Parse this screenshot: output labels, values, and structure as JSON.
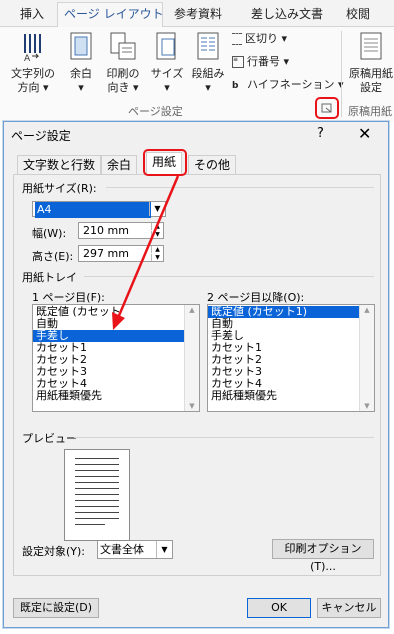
{
  "ribbon": {
    "tabs": [
      "挿入",
      "ページ レイアウト",
      "参考資料",
      "差し込み文書",
      "校閲"
    ],
    "active_tab": "ページ レイアウト",
    "buttons": [
      {
        "line1": "文字列の",
        "line2": "方向 ▾"
      },
      {
        "line1": "余白",
        "line2": "▾"
      },
      {
        "line1": "印刷の",
        "line2": "向き ▾"
      },
      {
        "line1": "サイズ",
        "line2": "▾"
      },
      {
        "line1": "段組み",
        "line2": "▾"
      }
    ],
    "small_buttons": [
      "区切り ▾",
      "行番号 ▾",
      "ハイフネーション ▾"
    ],
    "group_label": "ページ設定",
    "right_button": {
      "line1": "原稿用紙",
      "line2": "設定"
    },
    "right_group_label": "原稿用紙"
  },
  "dialog": {
    "title": "ページ設定",
    "help": "?",
    "close": "✕",
    "tabs": [
      "文字数と行数",
      "余白",
      "用紙",
      "その他"
    ],
    "selected_tab": "用紙",
    "paper_size": {
      "label": "用紙サイズ(R):",
      "value": "A4",
      "width_label": "幅(W):",
      "width_value": "210 mm",
      "height_label": "高さ(E):",
      "height_value": "297 mm"
    },
    "paper_tray": {
      "label": "用紙トレイ",
      "first_page_label": "1 ページ目(F):",
      "first_page_items": [
        "既定値 (カセット",
        "自動",
        "手差し",
        "カセット1",
        "カセット2",
        "カセット3",
        "カセット4",
        "用紙種類優先"
      ],
      "first_page_selected": 2,
      "other_pages_label": "2 ページ目以降(O):",
      "other_pages_items": [
        "既定値 (カセット1)",
        "自動",
        "手差し",
        "カセット1",
        "カセット2",
        "カセット3",
        "カセット4",
        "用紙種類優先"
      ],
      "other_pages_selected": 0
    },
    "preview_label": "プレビュー",
    "apply_to_label": "設定対象(Y):",
    "apply_to_value": "文書全体",
    "print_options_button": "印刷オプション(T)...",
    "default_button": "既定に設定(D)",
    "ok_button": "OK",
    "cancel_button": "キャンセル"
  },
  "annotation_color": "#e8141a"
}
